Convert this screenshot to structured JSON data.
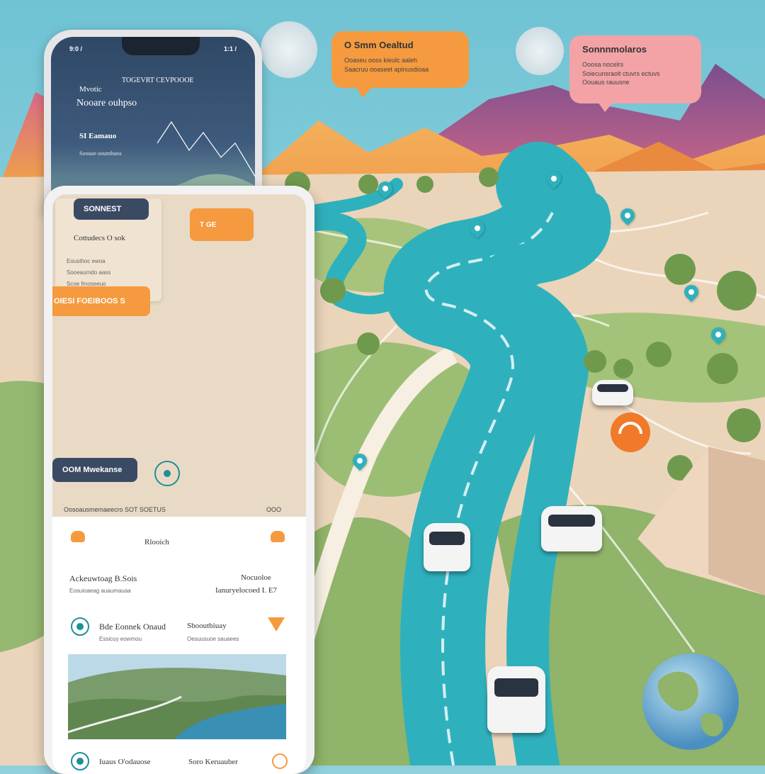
{
  "speech_bubbles": {
    "orange": {
      "title": "O Smm Oealtud",
      "sub": "Ooaseu ooss kieulc aaleh\nSaacruu ooaseet apinusdioaa"
    },
    "pink": {
      "title": "Sonnnmolaros",
      "sub": "Ooosa nocelrs\nSoiecunsraolt ctuvrs ectuvs\nOouaus rauusne"
    }
  },
  "phone_top": {
    "status_left": "9:0 /",
    "status_right": "1:1 /",
    "header": "TOGEVRT CEVPOOOE",
    "line1": "Mvotic",
    "line2": "Nooare ouhpso",
    "line3": "SI Eamauo",
    "line4": "Soouue ooumbuea"
  },
  "phone_bottom": {
    "sunset_pill": "SONNEST",
    "panel_title": "Cottudecs O sok",
    "panel_lines": [
      "Eousthoc ewoa",
      "Sooeaumdo aass",
      "Scoe fmoseeuo"
    ],
    "orange_pill_main": "OIESI FOEIBOOS S",
    "orange_tag": "T   GE",
    "navy_pill_bottom": "OOM Mwekanse",
    "caption_row": "Oosoausmemaeecro SOT   SOETUS",
    "caption_right": "OOO",
    "card_title": "Rlooich",
    "row1_left_title": "Ackeuwtoag B.Sois",
    "row1_left_sub": "Eosuioaeag auaumauaa",
    "row1_right_title": "Nocuoloe",
    "row1_right_sub": "Ianuryelocoed I. E7",
    "row2_left_title": "Bde Eonnek Onaud",
    "row2_left_sub": "Essicuy eowmou",
    "row2_right_title": "Sbooutbiuay",
    "row2_right_sub": "Oesuusuoe sauaees",
    "row3_left_title": "Iuaus O'odauose",
    "row3_right_title": "Soro Keruauber"
  },
  "colors": {
    "sky": "#8fd0dc",
    "river": "#2fb1bd",
    "accent_orange": "#f59a3f",
    "navy": "#3a4a63",
    "sand": "#e9d3b8",
    "grass": "#8fb46a"
  }
}
